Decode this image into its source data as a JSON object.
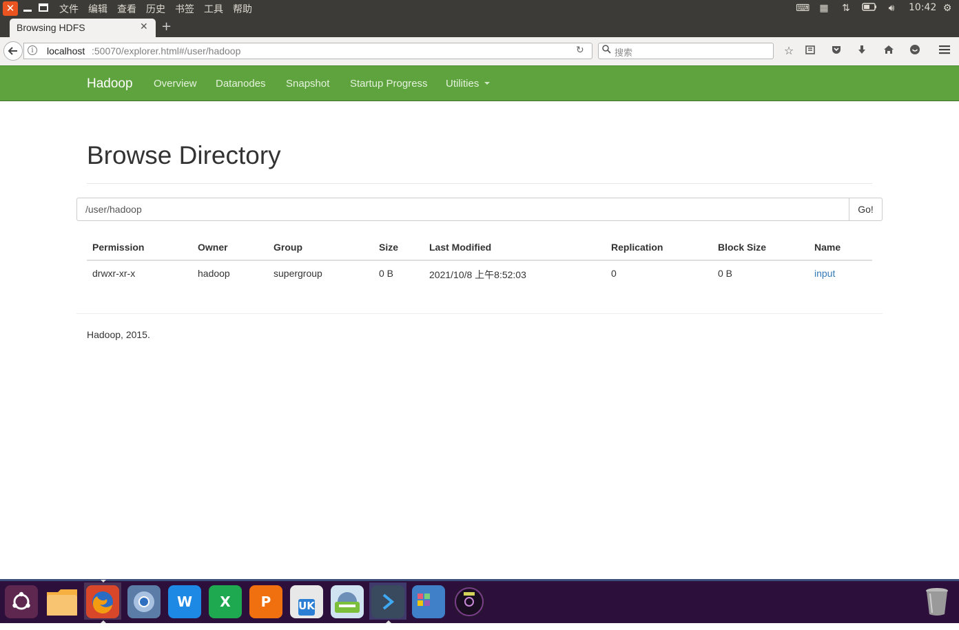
{
  "system_bar": {
    "menus": [
      "文件",
      "编辑",
      "查看",
      "历史",
      "书签",
      "工具",
      "帮助"
    ],
    "clock": "10:42"
  },
  "browser": {
    "tab_title": "Browsing HDFS",
    "url_host": "localhost",
    "url_rest": ":50070/explorer.html#/user/hadoop",
    "search_placeholder": "搜索"
  },
  "hadoop_nav": {
    "brand": "Hadoop",
    "links": [
      "Overview",
      "Datanodes",
      "Snapshot",
      "Startup Progress",
      "Utilities"
    ]
  },
  "page": {
    "title": "Browse Directory",
    "path_value": "/user/hadoop",
    "go_label": "Go!",
    "table": {
      "headers": [
        "Permission",
        "Owner",
        "Group",
        "Size",
        "Last Modified",
        "Replication",
        "Block Size",
        "Name"
      ],
      "rows": [
        [
          "drwxr-xr-x",
          "hadoop",
          "supergroup",
          "0 B",
          "2021/10/8 上午8:52:03",
          "0",
          "0 B",
          "input"
        ]
      ]
    },
    "footer": "Hadoop, 2015."
  },
  "dock": {
    "items": [
      "ubuntu-dash",
      "files",
      "firefox",
      "chromium",
      "wps-writer",
      "wps-spreadsheets",
      "wps-presentation",
      "ubuntu-kylin-software",
      "scanner",
      "vscode",
      "workspace-switcher",
      "disk-burner",
      "trash"
    ],
    "labels": {
      "writer": "W",
      "spreadsheet": "X",
      "presentation": "P",
      "kylin": "UK"
    }
  },
  "colors": {
    "hadoop_green": "#5fa33e",
    "link_blue": "#337ab7",
    "ubuntu_orange": "#e95420",
    "dock_bg": "#2c0f3a"
  }
}
